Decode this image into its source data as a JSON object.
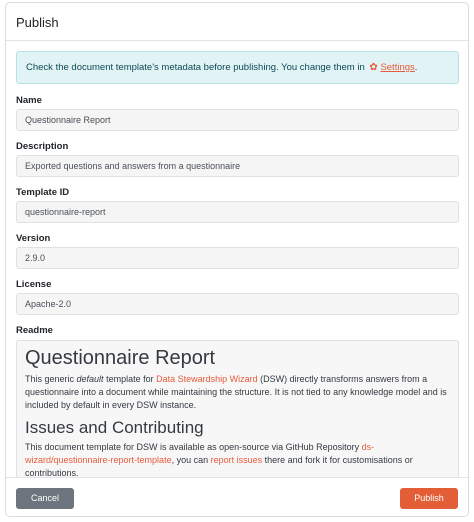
{
  "modal": {
    "title": "Publish"
  },
  "alert": {
    "text": "Check the document template's metadata before publishing. You change them in",
    "icon": "cogs-icon",
    "link": "Settings",
    "end": "."
  },
  "fields": {
    "name": {
      "label": "Name",
      "value": "Questionnaire Report"
    },
    "description": {
      "label": "Description",
      "value": "Exported questions and answers from a questionnaire"
    },
    "template_id": {
      "label": "Template ID",
      "value": "questionnaire-report"
    },
    "version": {
      "label": "Version",
      "value": "2.9.0"
    },
    "license": {
      "label": "License",
      "value": "Apache-2.0"
    },
    "readme": {
      "label": "Readme"
    }
  },
  "readme": {
    "h1": "Questionnaire Report",
    "p1_a": "This generic ",
    "p1_em": "default",
    "p1_b": " template for ",
    "p1_link": "Data Stewardship Wizard",
    "p1_c": " (DSW) directly transforms answers from a questionnaire into a document while maintaining the structure. It is not tied to any knowledge model and is included by default in every DSW instance.",
    "h2": "Issues and Contributing",
    "p2_a": "This document template for DSW is available as open-source via GitHub Repository ",
    "p2_link1": "ds-wizard/questionnaire-report-template",
    "p2_b": ", you can ",
    "p2_link2": "report issues",
    "p2_c": " there and fork it for customisations or contributions."
  },
  "footer": {
    "cancel_label": "Cancel",
    "publish_label": "Publish"
  },
  "colors": {
    "accent": "#e35d37",
    "alert_bg": "#e1f3f5",
    "cancel": "#6c757d"
  }
}
